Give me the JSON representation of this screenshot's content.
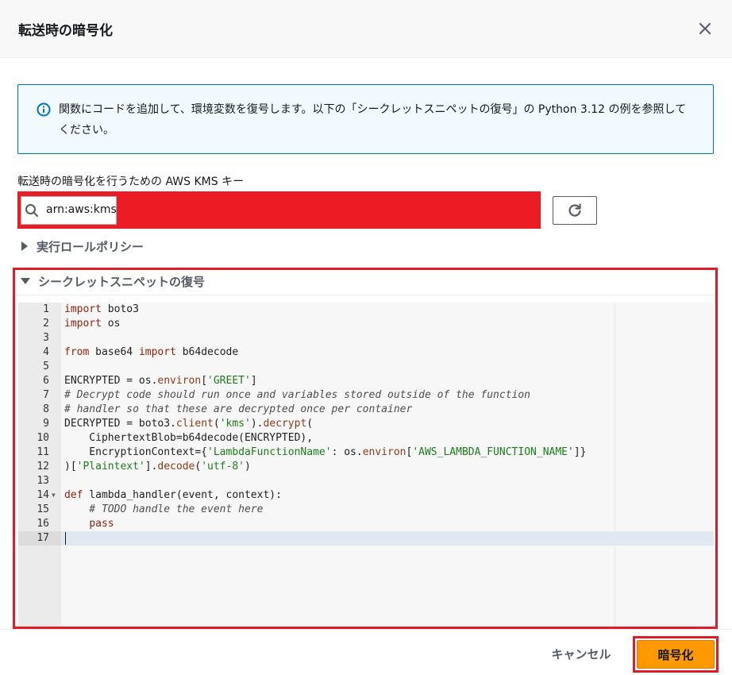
{
  "dialog": {
    "title": "転送時の暗号化",
    "close_icon": "close-icon"
  },
  "info": {
    "icon": "info-icon",
    "text": "関数にコードを追加して、環境変数を復号します。以下の「シークレットスニペットの復号」の Python 3.12 の例を参照してください。"
  },
  "kms": {
    "label": "転送時の暗号化を行うための AWS KMS キー",
    "value": "arn:aws:kms",
    "search_icon": "search-icon",
    "refresh_icon": "refresh-icon"
  },
  "sections": {
    "policy_label": "実行ロールポリシー",
    "policy_expanded": false,
    "snippet_label": "シークレットスニペットの復号",
    "snippet_expanded": true
  },
  "editor": {
    "active_line": 17,
    "lines": [
      {
        "n": "1",
        "tokens": [
          [
            "kw",
            "import"
          ],
          [
            "t",
            " boto3"
          ]
        ]
      },
      {
        "n": "2",
        "tokens": [
          [
            "kw",
            "import"
          ],
          [
            "t",
            " os"
          ]
        ]
      },
      {
        "n": "3",
        "tokens": []
      },
      {
        "n": "4",
        "tokens": [
          [
            "kw",
            "from"
          ],
          [
            "t",
            " base64 "
          ],
          [
            "kw",
            "import"
          ],
          [
            "t",
            " b64decode"
          ]
        ]
      },
      {
        "n": "5",
        "tokens": []
      },
      {
        "n": "6",
        "tokens": [
          [
            "t",
            "ENCRYPTED = os."
          ],
          [
            "fn",
            "environ"
          ],
          [
            "t",
            "["
          ],
          [
            "str",
            "'GREET'"
          ],
          [
            "t",
            "]"
          ]
        ]
      },
      {
        "n": "7",
        "tokens": [
          [
            "cm",
            "# Decrypt code should run once and variables stored outside of the function"
          ]
        ]
      },
      {
        "n": "8",
        "tokens": [
          [
            "cm",
            "# handler so that these are decrypted once per container"
          ]
        ]
      },
      {
        "n": "9",
        "tokens": [
          [
            "t",
            "DECRYPTED = boto3."
          ],
          [
            "fn",
            "client"
          ],
          [
            "t",
            "("
          ],
          [
            "str",
            "'kms'"
          ],
          [
            "t",
            ")."
          ],
          [
            "fn",
            "decrypt"
          ],
          [
            "t",
            "("
          ]
        ]
      },
      {
        "n": "10",
        "tokens": [
          [
            "t",
            "    CiphertextBlob=b64decode(ENCRYPTED),"
          ]
        ]
      },
      {
        "n": "11",
        "tokens": [
          [
            "t",
            "    EncryptionContext={"
          ],
          [
            "str",
            "'LambdaFunctionName'"
          ],
          [
            "t",
            ": os."
          ],
          [
            "fn",
            "environ"
          ],
          [
            "t",
            "["
          ],
          [
            "str",
            "'AWS_LAMBDA_FUNCTION_NAME'"
          ],
          [
            "t",
            "]}"
          ]
        ]
      },
      {
        "n": "12",
        "tokens": [
          [
            "t",
            ")["
          ],
          [
            "str",
            "'Plaintext'"
          ],
          [
            "t",
            "]."
          ],
          [
            "fn",
            "decode"
          ],
          [
            "t",
            "("
          ],
          [
            "str",
            "'utf-8'"
          ],
          [
            "t",
            ")"
          ]
        ]
      },
      {
        "n": "13",
        "tokens": []
      },
      {
        "n": "14",
        "fold": true,
        "tokens": [
          [
            "kw",
            "def"
          ],
          [
            "t",
            " lambda_handler(event, context):"
          ]
        ]
      },
      {
        "n": "15",
        "tokens": [
          [
            "cm",
            "    # TODO handle the event here"
          ]
        ]
      },
      {
        "n": "16",
        "tokens": [
          [
            "t",
            "    "
          ],
          [
            "kw",
            "pass"
          ]
        ]
      },
      {
        "n": "17",
        "tokens": []
      }
    ]
  },
  "footer": {
    "cancel_label": "キャンセル",
    "encrypt_label": "暗号化"
  },
  "colors": {
    "primary_button": "#ff9900",
    "info_border": "#0073bb",
    "highlight_red": "#e01c26"
  }
}
